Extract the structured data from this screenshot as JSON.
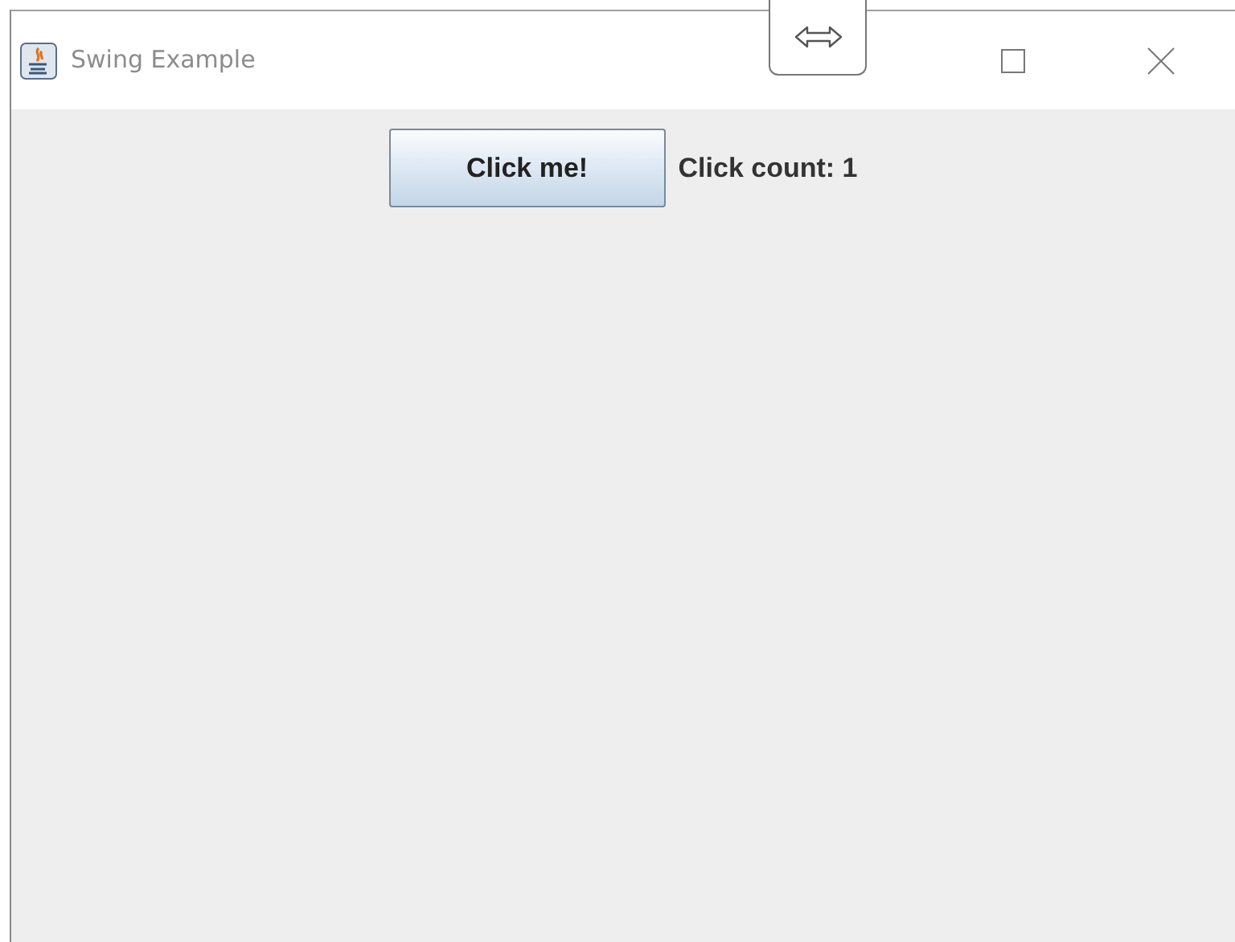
{
  "window": {
    "title": "Swing Example"
  },
  "content": {
    "button": {
      "label": "Click me!"
    },
    "label": "Click count: 1"
  }
}
